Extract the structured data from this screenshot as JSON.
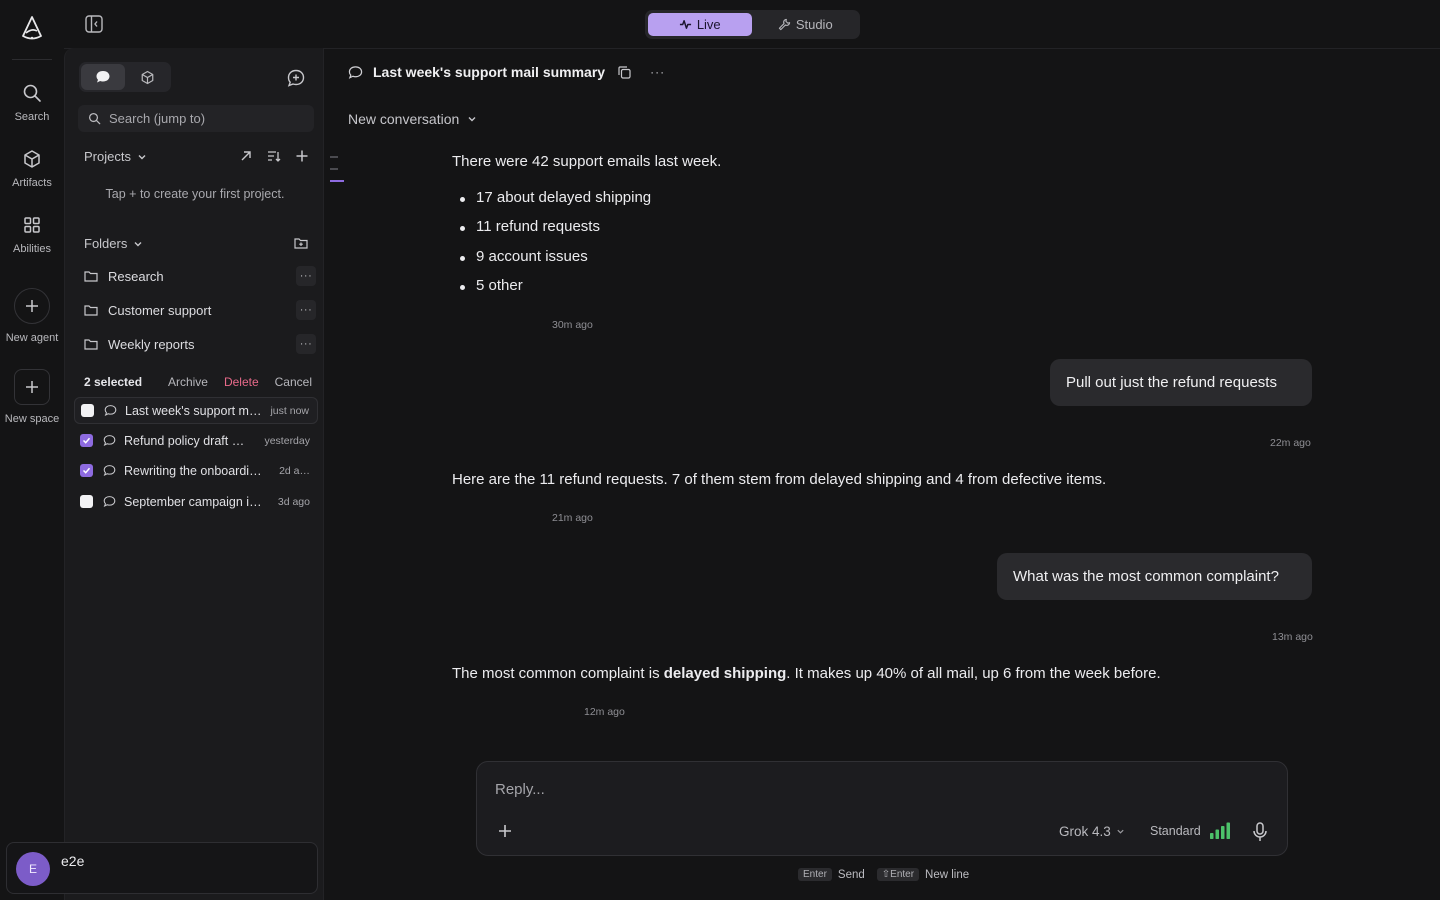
{
  "rail": {
    "items": [
      {
        "label": "Search",
        "icon": "search-icon"
      },
      {
        "label": "Artifacts",
        "icon": "cube-icon"
      },
      {
        "label": "Abilities",
        "icon": "grid-icon"
      },
      {
        "label": "New agent",
        "icon": "plus-icon"
      },
      {
        "label": "New space",
        "icon": "plus-icon"
      }
    ]
  },
  "topbar": {
    "modes": [
      {
        "label": "Live",
        "icon": "pulse-icon",
        "active": true
      },
      {
        "label": "Studio",
        "icon": "wrench-icon",
        "active": false
      }
    ]
  },
  "sidebar": {
    "search_placeholder": "Search (jump to)",
    "projects": {
      "title": "Projects",
      "empty_note": "Tap + to create your first project."
    },
    "folders": {
      "title": "Folders",
      "items": [
        {
          "label": "Research",
          "more": "···"
        },
        {
          "label": "Customer support",
          "more": "···"
        },
        {
          "label": "Weekly reports",
          "more": "···"
        }
      ]
    },
    "selection": {
      "count": "2 selected",
      "archive": "Archive",
      "delete": "Delete",
      "cancel": "Cancel"
    },
    "conversations": [
      {
        "title": "Last week's support mail summary",
        "time": "just now",
        "checked": false,
        "current": true
      },
      {
        "title": "Refund policy draft review",
        "time": "yesterday",
        "checked": true,
        "current": false
      },
      {
        "title": "Rewriting the onboarding email",
        "time": "2d a…",
        "checked": true,
        "current": false
      },
      {
        "title": "September campaign ideas",
        "time": "3d ago",
        "checked": false,
        "current": false
      }
    ],
    "user": {
      "initial": "E",
      "name": "e2e"
    }
  },
  "chat": {
    "title": "Last week's support mail summary",
    "more": "···",
    "conversation_select": "New conversation",
    "messages": {
      "m1_intro": "There were 42 support emails last week.",
      "m1_list": [
        "17 about delayed shipping",
        "11 refund requests",
        "9 account issues",
        "5 other"
      ],
      "m1_time": "30m ago",
      "u1": "Pull out just the refund requests",
      "u1_time": "22m ago",
      "m2": "Here are the 11 refund requests. 7 of them stem from delayed shipping and 4 from defective items.",
      "m2_time": "21m ago",
      "u2": "What was the most common complaint?",
      "u2_time": "13m ago",
      "m3_pre": "The most common complaint is ",
      "m3_bold": "delayed shipping",
      "m3_post": ". It makes up 40% of all mail, up 6 from the week before.",
      "m3_time": "12m ago"
    }
  },
  "composer": {
    "placeholder": "Reply...",
    "model": "Grok 4.3",
    "speed": "Standard",
    "hint_send_key": "Enter",
    "hint_send": "Send",
    "hint_newline_key": "⇧Enter",
    "hint_newline": "New line"
  },
  "colors": {
    "accent": "#b8a0f0",
    "checkbox": "#8e6be0",
    "danger": "#e86a8a",
    "signal": "#4cc26a"
  }
}
